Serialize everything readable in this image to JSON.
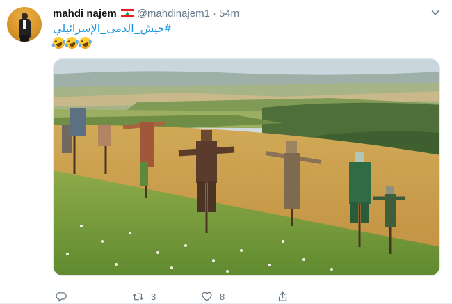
{
  "tweet": {
    "display_name": "mahdi najem",
    "flag_icon": "lebanon-flag-icon",
    "handle": "@mahdinajem1",
    "separator": "·",
    "time": "54m",
    "hashtag_text": "#جيش_الدمى_الإسرائيلي",
    "emoji_icon": "rolling-on-floor-laughing-emoji",
    "emoji_count": 3,
    "media": {
      "description_icon": "scarecrows-field-photo"
    },
    "actions": {
      "reply_icon": "reply-icon",
      "retweet_icon": "retweet-icon",
      "retweet_count": "3",
      "like_icon": "like-icon",
      "like_count": "8",
      "share_icon": "share-icon"
    }
  },
  "colors": {
    "link": "#1b95e0",
    "muted": "#657786",
    "text": "#14171a"
  }
}
